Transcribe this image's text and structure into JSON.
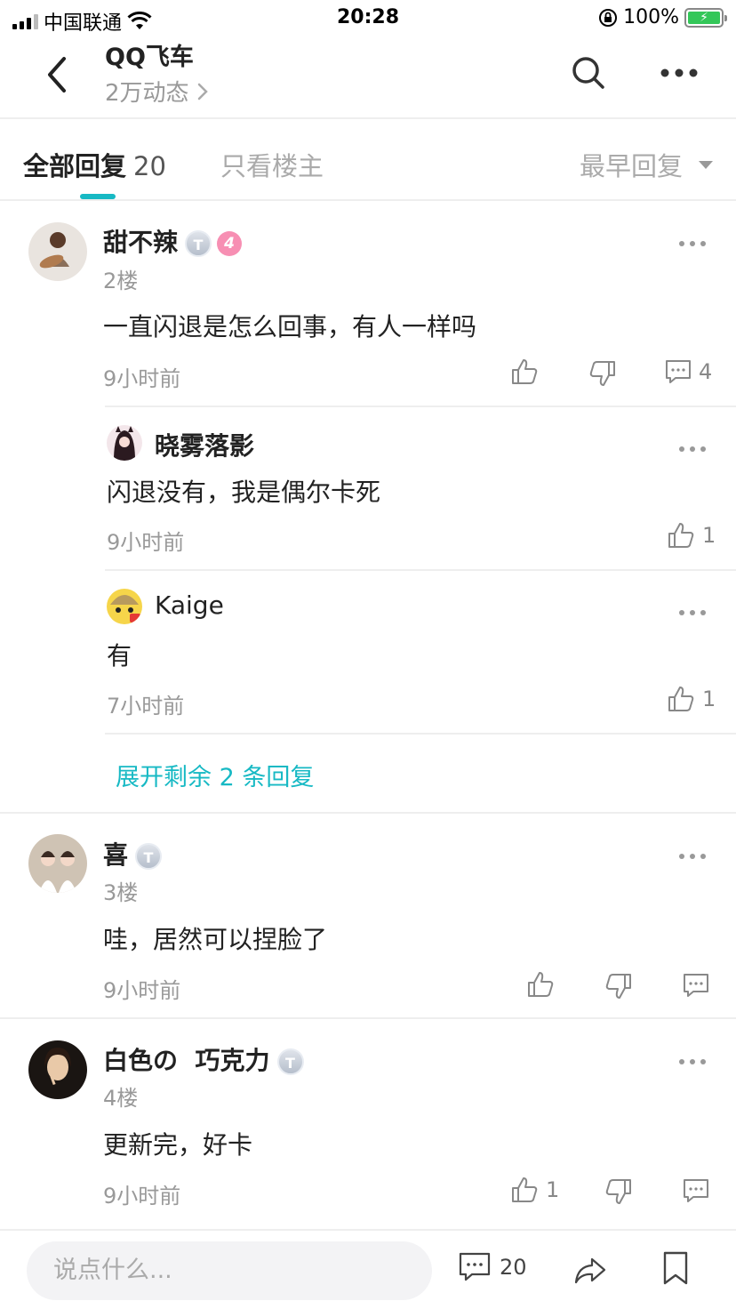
{
  "status": {
    "carrier": "中国联通",
    "time": "20:28",
    "battery": "100%"
  },
  "header": {
    "title": "QQ飞车",
    "subtitle": "2万动态"
  },
  "tabs": {
    "all_label": "全部回复",
    "all_count": "20",
    "owner_label": "只看楼主",
    "sort_label": "最早回复"
  },
  "comments": [
    {
      "name": "甜不辣",
      "level": "4",
      "floor": "2楼",
      "text": "一直闪退是怎么回事，有人一样吗",
      "time": "9小时前",
      "reply_count": "4",
      "replies": [
        {
          "name": "晓雾落影",
          "text": "闪退没有，我是偶尔卡死",
          "time": "9小时前",
          "likes": "1"
        },
        {
          "name": "Kaige",
          "text": "有",
          "time": "7小时前",
          "likes": "1"
        }
      ],
      "expand": "展开剩余 2 条回复"
    },
    {
      "name": "喜",
      "floor": "3楼",
      "text": "哇，居然可以捏脸了",
      "time": "9小时前"
    },
    {
      "name": "白色の  巧克力",
      "floor": "4楼",
      "text": "更新完，好卡",
      "time": "9小时前",
      "likes": "1"
    }
  ],
  "bottom": {
    "placeholder": "说点什么...",
    "comment_count": "20"
  },
  "colors": {
    "accent": "#17b9c4",
    "level_badge": "#f78fb3",
    "battery": "#34c759"
  },
  "icons": [
    "back-icon",
    "search-icon",
    "more-icon",
    "thumb-up-icon",
    "thumb-down-icon",
    "comment-icon",
    "share-icon",
    "bookmark-icon"
  ]
}
